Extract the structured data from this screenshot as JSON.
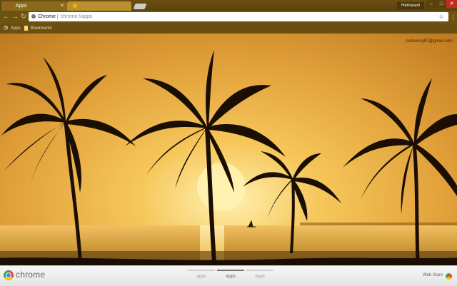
{
  "window": {
    "tabs": [
      {
        "label": "Apps",
        "active": true
      },
      {
        "label": "",
        "active": false
      }
    ],
    "profile_name": "Hemaram",
    "controls": [
      "minimize",
      "maximize",
      "close"
    ]
  },
  "toolbar": {
    "chip_label": "Chrome",
    "url": "chrome://apps"
  },
  "bookmarks": {
    "items": [
      {
        "label": "Apps",
        "icon": "apps-grid-icon"
      },
      {
        "label": "Bookmarks",
        "icon": "folder-icon"
      }
    ]
  },
  "account": {
    "email": "cxdonnoy87@gmail.com"
  },
  "bottom_bar": {
    "brand": "chrome",
    "pages": [
      {
        "label": "Apps",
        "active": false
      },
      {
        "label": "Apps",
        "active": true
      },
      {
        "label": "Apps",
        "active": false
      }
    ],
    "webstore_label": "Web Store"
  },
  "colors": {
    "sky_top": "#e7a83a",
    "sun": "#ffe08a",
    "sea": "#c8901e",
    "silhouette": "#1b0e02",
    "close_button": "#c42b1c"
  }
}
